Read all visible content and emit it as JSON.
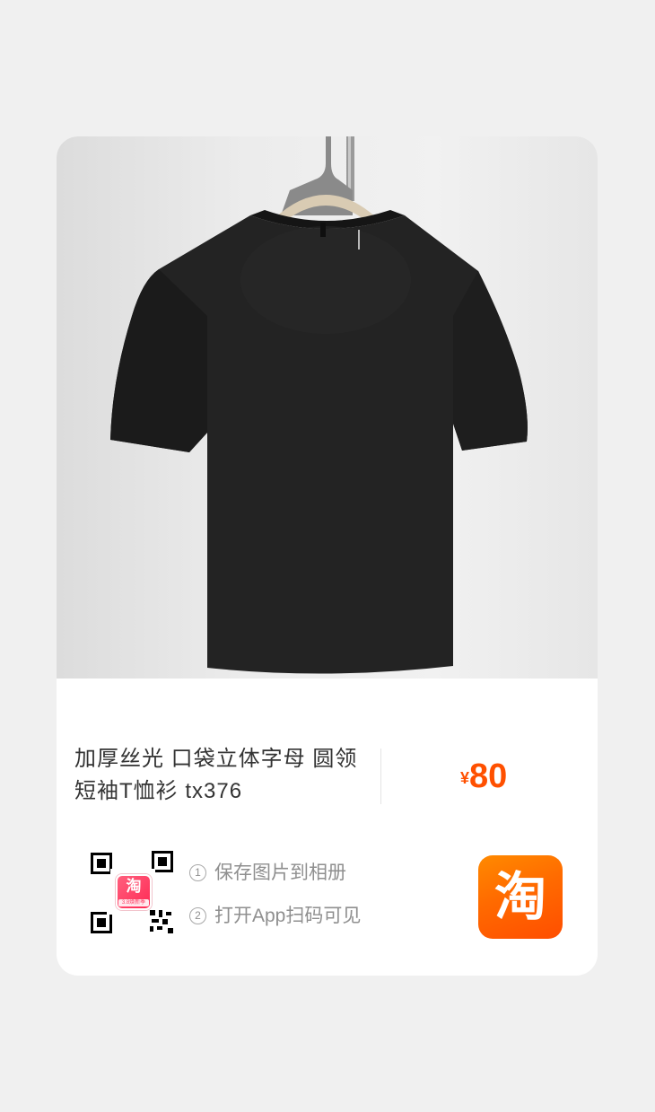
{
  "product": {
    "title": "加厚丝光 口袋立体字母 圆领短袖T恤衫 tx376",
    "currency_symbol": "¥",
    "price": "80"
  },
  "steps": [
    {
      "number": "1",
      "text": "保存图片到相册"
    },
    {
      "number": "2",
      "text": "打开App扫码可见"
    }
  ],
  "qr": {
    "logo_char": "淘",
    "logo_sub": "3.8焕新季"
  },
  "taobao_app": {
    "char": "淘",
    "icon": "taobao-app-icon"
  },
  "colors": {
    "price": "#ff5000",
    "taobao_orange": "#ff6a00",
    "background": "#f0f0f0"
  }
}
